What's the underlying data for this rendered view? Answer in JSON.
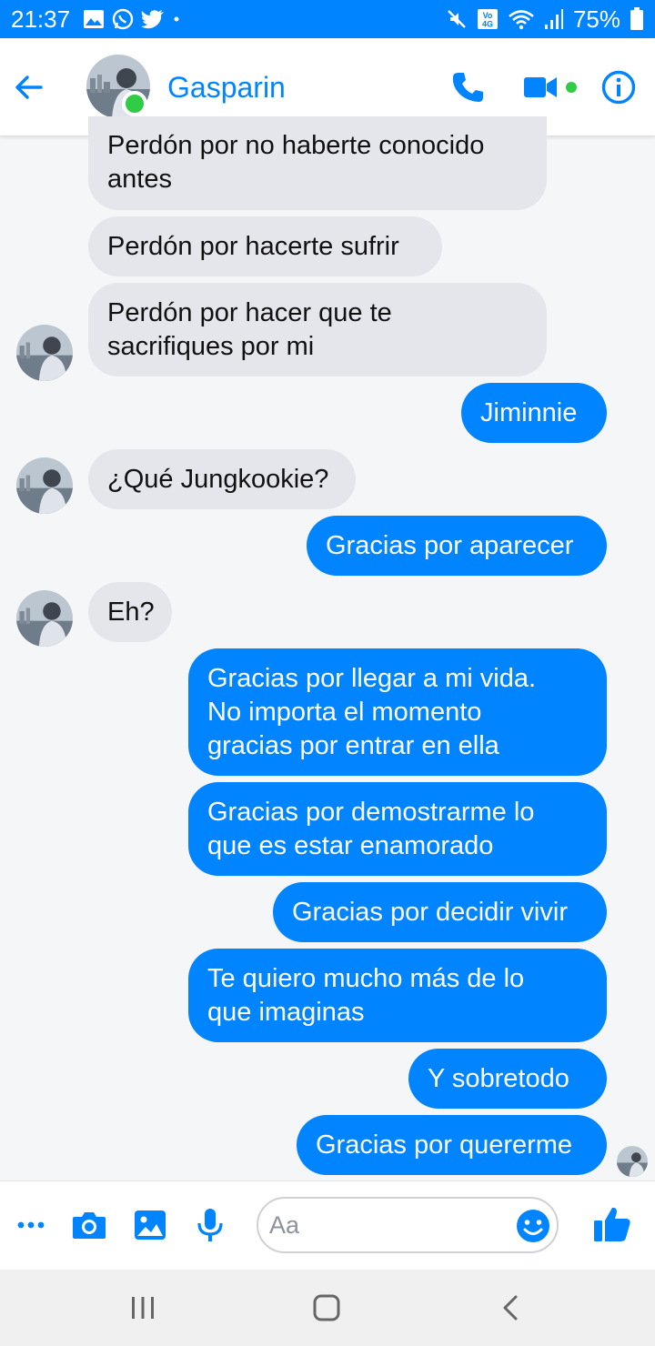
{
  "status_bar": {
    "time": "21:37",
    "battery": "75%",
    "left_icons": [
      "image-icon",
      "whatsapp-icon",
      "twitter-icon",
      "dot-icon"
    ],
    "right_icons": [
      "mute-icon",
      "volte-icon",
      "wifi-icon",
      "signal-icon",
      "battery-icon"
    ]
  },
  "header": {
    "contact_name": "Gasparin",
    "online": true,
    "icons": [
      "back-arrow-icon",
      "phone-icon",
      "video-camera-icon",
      "info-icon"
    ]
  },
  "messages": [
    {
      "side": "in",
      "text": "Perdón por no haberte conocido\nantes"
    },
    {
      "side": "in",
      "text": "Perdón por hacerte sufrir"
    },
    {
      "side": "in",
      "text": "Perdón por hacer que te\nsacrifiques por mi"
    },
    {
      "side": "out",
      "text": "Jiminnie"
    },
    {
      "side": "in",
      "text": "¿Qué Jungkookie?"
    },
    {
      "side": "out",
      "text": "Gracias por aparecer"
    },
    {
      "side": "in",
      "text": "Eh?"
    },
    {
      "side": "out",
      "text": "Gracias por llegar a mi vida.\nNo importa el momento\ngracias por entrar en ella"
    },
    {
      "side": "out",
      "text": "Gracias por demostrarme lo\nque es estar enamorado"
    },
    {
      "side": "out",
      "text": "Gracias por decidir vivir"
    },
    {
      "side": "out",
      "text": "Te quiero mucho más de lo\nque imaginas"
    },
    {
      "side": "out",
      "text": "Y sobretodo"
    },
    {
      "side": "out",
      "text": "Gracias por quererme"
    }
  ],
  "composer": {
    "placeholder": "Aa",
    "icons": [
      "more-icon",
      "camera-icon",
      "gallery-icon",
      "microphone-icon",
      "emoji-icon",
      "like-icon"
    ]
  },
  "nav_bar": {
    "icons": [
      "recent-apps-icon",
      "home-icon",
      "back-icon"
    ]
  },
  "colors": {
    "accent": "#0084ff",
    "incoming_bubble": "#e4e6eb",
    "online": "#31cc46"
  }
}
